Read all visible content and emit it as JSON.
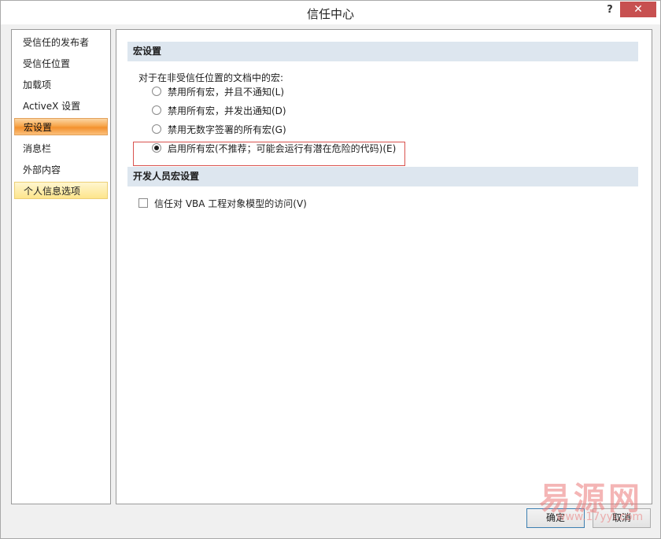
{
  "window": {
    "title": "信任中心",
    "help": "?",
    "close": "✕"
  },
  "nav": {
    "items": [
      {
        "label": "受信任的发布者"
      },
      {
        "label": "受信任位置"
      },
      {
        "label": "加载项"
      },
      {
        "label": "ActiveX 设置"
      },
      {
        "label": "宏设置"
      },
      {
        "label": "消息栏"
      },
      {
        "label": "外部内容"
      },
      {
        "label": "个人信息选项"
      }
    ]
  },
  "macro": {
    "header": "宏设置",
    "prompt": "对于在非受信任位置的文档中的宏:",
    "options": [
      {
        "label": "禁用所有宏，并且不通知(L)"
      },
      {
        "label": "禁用所有宏，并发出通知(D)"
      },
      {
        "label": "禁用无数字签署的所有宏(G)"
      },
      {
        "label": "启用所有宏(不推荐；可能会运行有潜在危险的代码)(E)"
      }
    ],
    "selected_index": 3
  },
  "developer": {
    "header": "开发人员宏设置",
    "vba_access_label": "信任对 VBA 工程对象模型的访问(V)",
    "vba_access_checked": false
  },
  "buttons": {
    "ok": "确定",
    "cancel": "取消"
  },
  "watermark": {
    "text": "易源网",
    "url": "www.17yyi.com"
  },
  "colors": {
    "active_nav": "#f7a64b",
    "hover_nav": "#fde58c",
    "section_header": "#dde6ef",
    "highlight_box": "#d9534f",
    "close_button": "#c75050"
  }
}
